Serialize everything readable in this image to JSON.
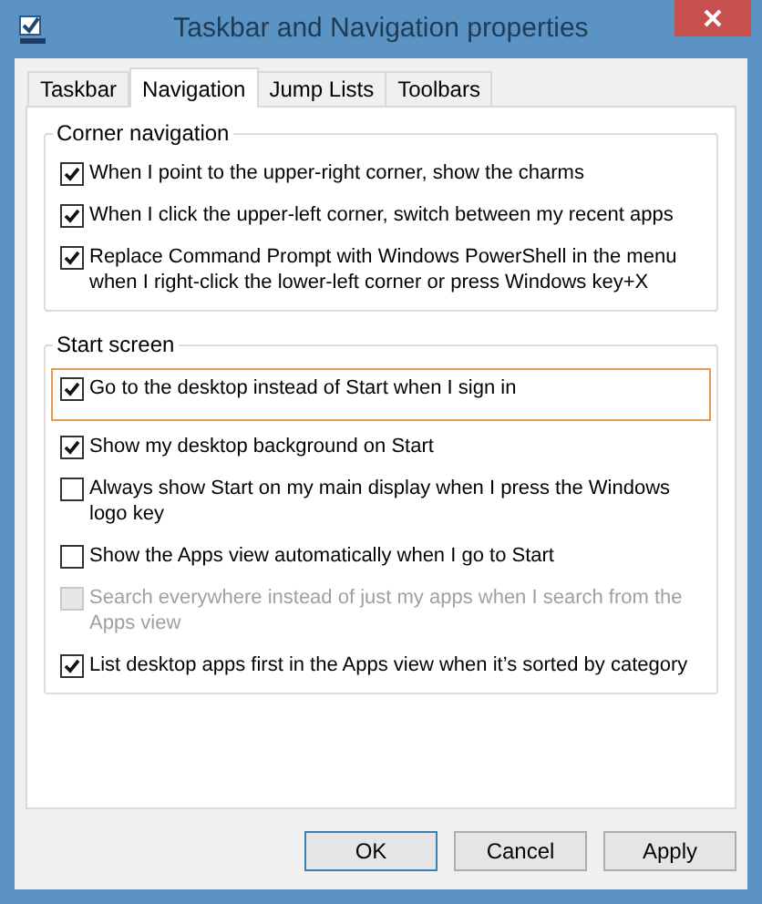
{
  "window": {
    "title": "Taskbar and Navigation properties"
  },
  "tabs": [
    {
      "label": "Taskbar",
      "selected": false
    },
    {
      "label": "Navigation",
      "selected": true
    },
    {
      "label": "Jump Lists",
      "selected": false
    },
    {
      "label": "Toolbars",
      "selected": false
    }
  ],
  "groups": [
    {
      "title": "Corner navigation",
      "options": [
        {
          "label": "When I point to the upper-right corner, show the charms",
          "checked": true,
          "disabled": false,
          "highlighted": false
        },
        {
          "label": "When I click the upper-left corner, switch between my recent apps",
          "checked": true,
          "disabled": false,
          "highlighted": false
        },
        {
          "label": "Replace Command Prompt with Windows PowerShell in the menu when I right-click the lower-left corner or press Windows key+X",
          "checked": true,
          "disabled": false,
          "highlighted": false
        }
      ]
    },
    {
      "title": "Start screen",
      "options": [
        {
          "label": "Go to the desktop instead of Start when I sign in",
          "checked": true,
          "disabled": false,
          "highlighted": true
        },
        {
          "label": "Show my desktop background on Start",
          "checked": true,
          "disabled": false,
          "highlighted": false
        },
        {
          "label": "Always show Start on my main display when I press the Windows logo key",
          "checked": false,
          "disabled": false,
          "highlighted": false
        },
        {
          "label": "Show the Apps view automatically when I go to Start",
          "checked": false,
          "disabled": false,
          "highlighted": false
        },
        {
          "label": "Search everywhere instead of just my apps when I search from the Apps view",
          "checked": false,
          "disabled": true,
          "highlighted": false
        },
        {
          "label": "List desktop apps first in the Apps view when it’s sorted by category",
          "checked": true,
          "disabled": false,
          "highlighted": false
        }
      ]
    }
  ],
  "buttons": [
    {
      "label": "OK",
      "default": true
    },
    {
      "label": "Cancel",
      "default": false
    },
    {
      "label": "Apply",
      "default": false
    }
  ]
}
